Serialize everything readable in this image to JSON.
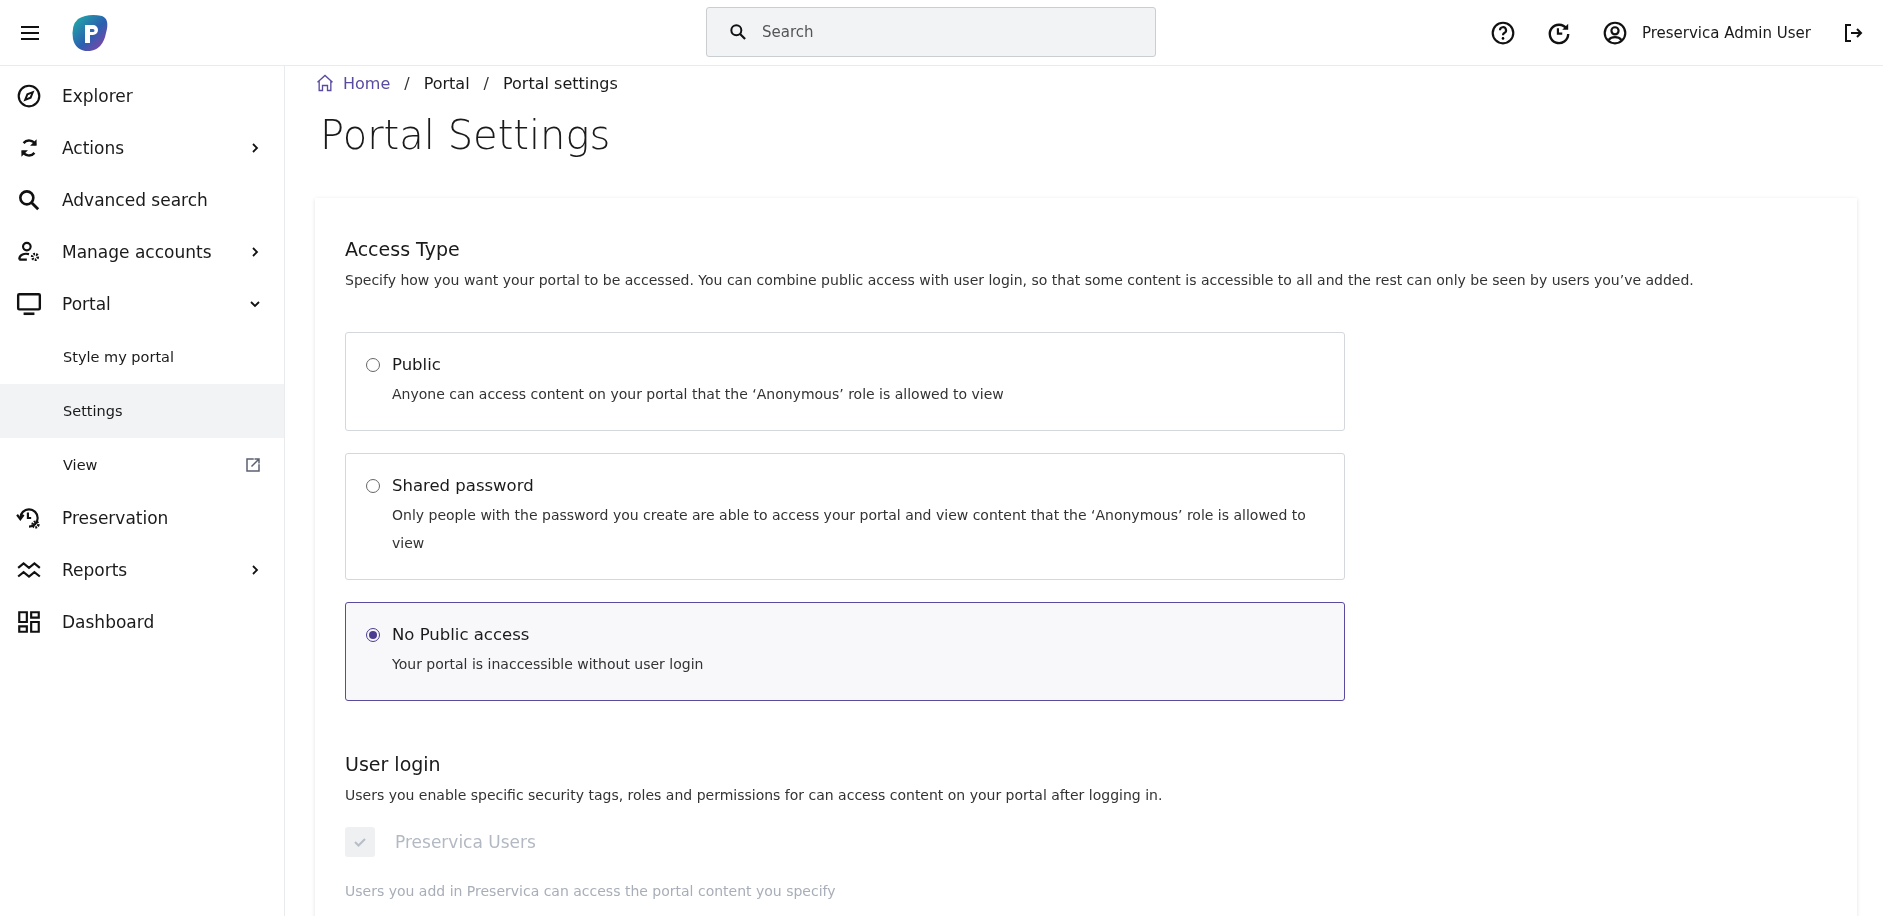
{
  "header": {
    "search": {
      "placeholder": "Search"
    },
    "user_name": "Preservica Admin User"
  },
  "sidebar": {
    "items": [
      {
        "label": "Explorer",
        "kind": "main",
        "selected": false
      },
      {
        "label": "Actions",
        "kind": "main",
        "selected": false,
        "expanded": false
      },
      {
        "label": "Advanced search",
        "kind": "main",
        "selected": false
      },
      {
        "label": "Manage accounts",
        "kind": "main",
        "selected": false,
        "expanded": false
      },
      {
        "label": "Portal",
        "kind": "main",
        "selected": false,
        "expanded": true,
        "children": [
          {
            "label": "Style my portal",
            "selected": false,
            "external": false
          },
          {
            "label": "Settings",
            "selected": true,
            "external": false
          },
          {
            "label": "View",
            "selected": false,
            "external": true
          }
        ]
      },
      {
        "label": "Preservation",
        "kind": "main",
        "selected": false
      },
      {
        "label": "Reports",
        "kind": "main",
        "selected": false,
        "expanded": false
      },
      {
        "label": "Dashboard",
        "kind": "main",
        "selected": false
      }
    ]
  },
  "breadcrumb": [
    {
      "label": "Home"
    },
    {
      "label": "Portal",
      "separator": "/"
    },
    {
      "label": "Portal settings",
      "separator": "/"
    }
  ],
  "page_title": "Portal Settings",
  "access_type": {
    "heading": "Access Type",
    "description": "Specify how you want your portal to be accessed. You can combine public access with user login, so that some content is accessible to all and the rest can only be seen by users you’ve added.",
    "options": [
      {
        "title": "Public",
        "description": "Anyone can access content on your portal that the ‘Anonymous’ role is allowed to view",
        "selected": false
      },
      {
        "title": "Shared password",
        "description": "Only people with the password you create are able to access your portal and view content that the ‘Anonymous’ role is allowed to view",
        "selected": false
      },
      {
        "title": "No Public access",
        "description": "Your portal is inaccessible without user login",
        "selected": true
      }
    ]
  },
  "user_login": {
    "heading": "User login",
    "description": "Users you enable specific security tags, roles and permissions for can access content on your portal after logging in.",
    "checkbox": {
      "label": "Preservica Users",
      "checked": true,
      "disabled": true,
      "description": "Users you add in Preservica can access the portal content you specify"
    }
  }
}
